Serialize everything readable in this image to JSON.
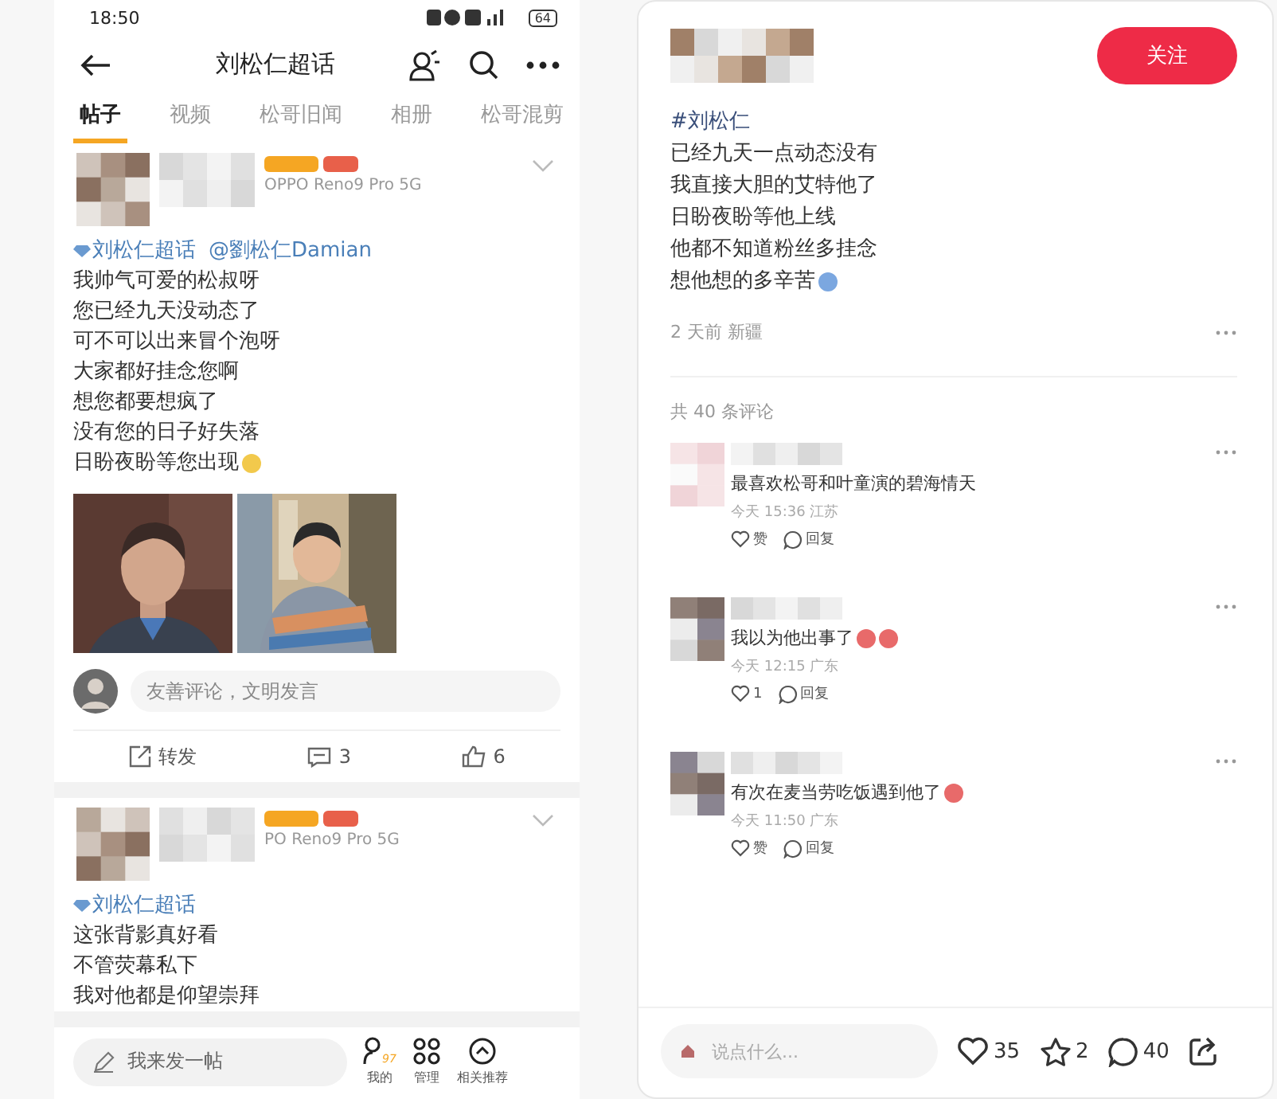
{
  "left": {
    "status_bar": {
      "time": "18:50",
      "battery": "64"
    },
    "header": {
      "title": "刘松仁超话"
    },
    "tabs": [
      {
        "label": "帖子",
        "selected": true
      },
      {
        "label": "视频",
        "selected": false
      },
      {
        "label": "松哥旧闻",
        "selected": false
      },
      {
        "label": "相册",
        "selected": false
      },
      {
        "label": "松哥混剪",
        "selected": false
      }
    ],
    "posts": [
      {
        "device": "OPPO Reno9 Pro 5G",
        "topic": "刘松仁超话",
        "mention": "@劉松仁Damian",
        "lines": [
          {
            "text": "我帅气可爱的松叔呀"
          },
          {
            "text": "您已经九天没动态了"
          },
          {
            "text": "可不可以出来冒个泡呀"
          },
          {
            "text": "大家都好挂念您啊"
          },
          {
            "text": "想您都要想疯了"
          },
          {
            "text": "没有您的日子好失落"
          },
          {
            "text": "日盼夜盼等您出现",
            "emoji": {
              "color": "#f2c94c"
            }
          }
        ],
        "comment_placeholder": "友善评论，文明发言",
        "actions": {
          "repost": "转发",
          "comments": "3",
          "likes": "6"
        }
      },
      {
        "device": "PO Reno9 Pro 5G",
        "topic": "刘松仁超话",
        "lines": [
          {
            "text": "这张背影真好看"
          },
          {
            "text": "不管荧幕私下"
          },
          {
            "text": "我对他都是仰望崇拜"
          }
        ]
      }
    ],
    "bottom_bar": {
      "placeholder": "我来发一帖",
      "buttons": [
        {
          "kind": "me",
          "label": "我的",
          "badge": "97"
        },
        {
          "kind": "manage",
          "label": "管理"
        },
        {
          "kind": "related",
          "label": "相关推荐"
        }
      ]
    }
  },
  "right": {
    "follow_button": "关注",
    "hashtag": "#刘松仁",
    "lines": [
      {
        "text": "已经九天一点动态没有"
      },
      {
        "text": "我直接大胆的艾特他了"
      },
      {
        "text": "日盼夜盼等他上线"
      },
      {
        "text": "他都不知道粉丝多挂念"
      },
      {
        "text": "想他想的多辛苦",
        "emoji": {
          "color": "#7ba7e0"
        }
      }
    ],
    "meta": "2 天前 新疆",
    "comment_count": "共 40 条评论",
    "comments": [
      {
        "text": "最喜欢松哥和叶童演的碧海情天",
        "time": "今天 15:36 江苏",
        "like": "赞",
        "reply": "回复"
      },
      {
        "text": "我以为他出事了",
        "emojis": [
          {
            "color": "#e86a6a"
          },
          {
            "color": "#e86a6a"
          }
        ],
        "time": "今天 12:15 广东",
        "like": "1",
        "reply": "回复"
      },
      {
        "text": "有次在麦当劳吃饭遇到他了",
        "emojis": [
          {
            "color": "#e86a6a"
          }
        ],
        "time": "今天 11:50 广东",
        "like": "赞",
        "reply": "回复"
      }
    ],
    "bottom_bar": {
      "placeholder": "说点什么...",
      "likes": "35",
      "favorites": "2",
      "comments": "40"
    }
  }
}
